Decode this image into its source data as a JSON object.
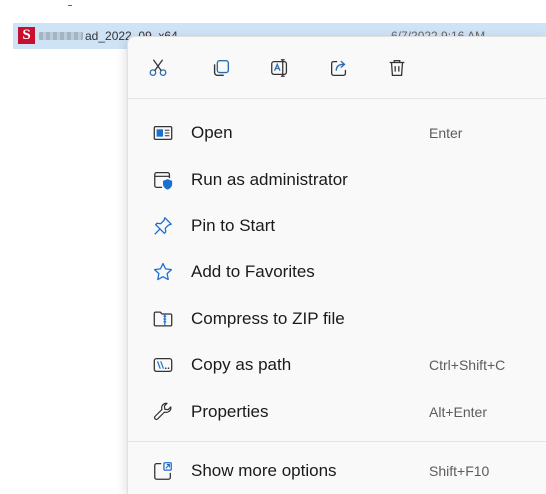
{
  "file_row": {
    "icon_letter": "S",
    "name_visible": "ad_2022_09_x64",
    "date": "6/7/2022 9:16 AM"
  },
  "context_menu": {
    "quick_actions": [
      {
        "name": "cut",
        "icon": "scissors-icon"
      },
      {
        "name": "copy",
        "icon": "copy-icon"
      },
      {
        "name": "rename",
        "icon": "rename-icon"
      },
      {
        "name": "share",
        "icon": "share-icon"
      },
      {
        "name": "delete",
        "icon": "trash-icon"
      }
    ],
    "items": [
      {
        "label": "Open",
        "shortcut": "Enter",
        "icon": "open-window-icon"
      },
      {
        "label": "Run as administrator",
        "shortcut": "",
        "icon": "shield-window-icon"
      },
      {
        "label": "Pin to Start",
        "shortcut": "",
        "icon": "pin-icon"
      },
      {
        "label": "Add to Favorites",
        "shortcut": "",
        "icon": "star-icon"
      },
      {
        "label": "Compress to ZIP file",
        "shortcut": "",
        "icon": "zip-folder-icon"
      },
      {
        "label": "Copy as path",
        "shortcut": "Ctrl+Shift+C",
        "icon": "path-icon"
      },
      {
        "label": "Properties",
        "shortcut": "Alt+Enter",
        "icon": "wrench-icon"
      },
      {
        "label": "Show more options",
        "shortcut": "Shift+F10",
        "icon": "more-options-icon"
      }
    ]
  },
  "colors": {
    "accent": "#1a6fd1",
    "menu_bg": "#f9f9f9",
    "selection": "#cfe3f7"
  }
}
